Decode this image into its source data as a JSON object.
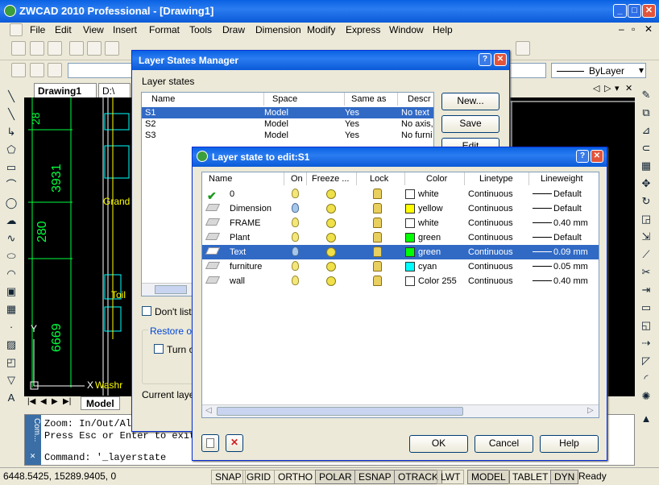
{
  "app": {
    "title": "ZWCAD 2010 Professional - [Drawing1]"
  },
  "menu": [
    "File",
    "Edit",
    "View",
    "Insert",
    "Format",
    "Tools",
    "Draw",
    "Dimension",
    "Modify",
    "Express",
    "Window",
    "Help"
  ],
  "toolbar": {
    "linetype_combo": "ByLayer"
  },
  "drawing_tabs": [
    "Drawing1",
    "D:\\"
  ],
  "layout_tabs": {
    "model": "Model"
  },
  "canvas": {
    "dims": [
      "28",
      "3931",
      "280",
      "6669"
    ],
    "labels": [
      "Grand",
      "Toil",
      "Washr"
    ],
    "axis_y": "Y",
    "axis_x": "X"
  },
  "command": {
    "lines": [
      "Zoom:  In/Out/Al",
      "Press Esc or Enter to exit"
    ],
    "prompt": "Command:  '_layerstate",
    "side_label": "Com..."
  },
  "status": {
    "coords": "6448.5425, 15289.9405, 0",
    "buttons": [
      "SNAP",
      "GRID",
      "ORTHO",
      "POLAR",
      "ESNAP",
      "OTRACK",
      "LWT",
      "MODEL",
      "TABLET",
      "DYN"
    ],
    "ready": "Ready"
  },
  "lsm": {
    "title": "Layer States Manager",
    "group_label": "Layer states",
    "headers": [
      "Name",
      "Space",
      "Same as ...",
      "Descr"
    ],
    "rows": [
      {
        "name": "S1",
        "space": "Model",
        "same": "Yes",
        "desc": "No text"
      },
      {
        "name": "S2",
        "space": "Model",
        "same": "Yes",
        "desc": "No axis,"
      },
      {
        "name": "S3",
        "space": "Model",
        "same": "Yes",
        "desc": "No furni"
      }
    ],
    "buttons": {
      "new": "New...",
      "save": "Save",
      "edit": "Edit"
    },
    "dont_list": "Don't list l",
    "restore": "Restore op",
    "turn_off": "Turn o",
    "current_layer": "Current layer"
  },
  "edit": {
    "title": "Layer state to edit:S1",
    "headers": [
      "Name",
      "On",
      "Freeze ...",
      "Lock",
      "Color",
      "Linetype",
      "Lineweight"
    ],
    "rows": [
      {
        "name": "0",
        "color": "white",
        "swatch": "#ffffff",
        "linetype": "Continuous",
        "lw": "Default",
        "current": true
      },
      {
        "name": "Dimension",
        "color": "yellow",
        "swatch": "#ffff00",
        "linetype": "Continuous",
        "lw": "Default"
      },
      {
        "name": "FRAME",
        "color": "white",
        "swatch": "#ffffff",
        "linetype": "Continuous",
        "lw": "0.40 mm"
      },
      {
        "name": "Plant",
        "color": "green",
        "swatch": "#00ff00",
        "linetype": "Continuous",
        "lw": "Default"
      },
      {
        "name": "Text",
        "color": "green",
        "swatch": "#00ff00",
        "linetype": "Continuous",
        "lw": "0.09 mm",
        "selected": true,
        "off": true
      },
      {
        "name": "furniture",
        "color": "cyan",
        "swatch": "#00ffff",
        "linetype": "Continuous",
        "lw": "0.05 mm"
      },
      {
        "name": "wall",
        "color": "Color 255",
        "swatch": "#ffffff",
        "linetype": "Continuous",
        "lw": "0.40 mm"
      }
    ],
    "buttons": {
      "ok": "OK",
      "cancel": "Cancel",
      "help": "Help"
    }
  }
}
